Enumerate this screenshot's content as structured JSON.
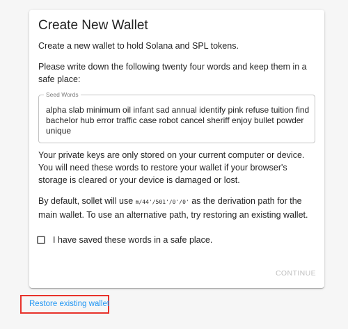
{
  "card": {
    "title": "Create New Wallet",
    "intro": "Create a new wallet to hold Solana and SPL tokens.",
    "instruction": "Please write down the following twenty four words and keep them in a safe place:",
    "seed_label": "Seed Words",
    "seed_words": "alpha slab minimum oil infant sad annual identify pink refuse tuition find bachelor hub error traffic case robot cancel sheriff enjoy bullet powder unique",
    "warning": "Your private keys are only stored on your current computer or device. You will need these words to restore your wallet if your browser's storage is cleared or your device is damaged or lost.",
    "derivation_prefix": "By default, sollet will use ",
    "derivation_path": "m/44'/501'/0'/0'",
    "derivation_suffix": " as the derivation path for the main wallet. To use an alternative path, try restoring an existing wallet.",
    "checkbox_label": "I have saved these words in a safe place.",
    "checkbox_checked": false,
    "continue_label": "CONTINUE"
  },
  "restore_link": "Restore existing wallet",
  "colors": {
    "link": "#2196f3",
    "highlight_border": "#e8322b",
    "disabled_text": "rgba(0,0,0,0.26)"
  }
}
